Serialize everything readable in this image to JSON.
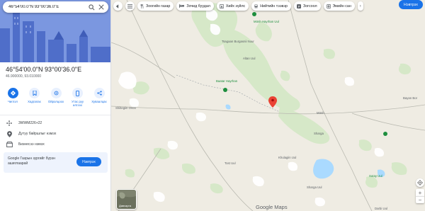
{
  "search": {
    "query": "46°54'00.0\"N 93°00'36.0\"E"
  },
  "place": {
    "title": "46°54'00.0\"N 93°00'36.0\"E",
    "coords": "46.900000, 93.010000"
  },
  "actions": [
    {
      "label": "Чиглэл",
      "icon": "directions-icon"
    },
    {
      "label": "Хадгалах",
      "icon": "bookmark-icon"
    },
    {
      "label": "Ойролцоох",
      "icon": "nearby-icon"
    },
    {
      "label": "Утас руу илгээх",
      "icon": "phone-icon"
    },
    {
      "label": "Хуваалцах",
      "icon": "share-icon"
    }
  ],
  "info_rows": [
    {
      "text": "3WWM226+22",
      "icon": "plus-code-icon"
    },
    {
      "text": "Дутуу байршлыг нэмэх",
      "icon": "add-place-icon"
    },
    {
      "text": "Бизнесээ нэмэх",
      "icon": "business-icon"
    }
  ],
  "ad_card": {
    "text": "Google Газрын зургийг бүрэн ашиглаарай",
    "button": "Нэвтрэх"
  },
  "chips": [
    {
      "label": "Зоогийн газар",
      "icon": "restaurant-icon"
    },
    {
      "label": "Зочид буудал",
      "icon": "hotel-icon"
    },
    {
      "label": "Хийх зүйлс",
      "icon": "things-icon"
    },
    {
      "label": "Нийтийн тээвэр",
      "icon": "transit-icon"
    },
    {
      "label": "Зогсоол",
      "icon": "parking-icon"
    },
    {
      "label": "Эмийн сан",
      "icon": "pharmacy-icon"
    }
  ],
  "login_button": "Нэвтрэх",
  "layers_label": "Давхарга",
  "map_labels": [
    {
      "text": "Tsagaan Burgasnii Nuur",
      "green": false
    },
    {
      "text": "Tsagaan Burgasnii Nuur",
      "green": false
    },
    {
      "text": "Tsagaan Burgasnii Nuur",
      "green": false
    },
    {
      "text": "Altan Uul",
      "green": false
    },
    {
      "text": "Baatar Hayrhan",
      "green": true
    },
    {
      "text": "Baatar Hayrhan",
      "green": false
    },
    {
      "text": "Mönh Hayrhan Uul",
      "green": true
    },
    {
      "text": "Mönh Hayrhan Uul",
      "green": false
    },
    {
      "text": "Shiltegiin Ovoo",
      "green": false
    },
    {
      "text": "Mönh",
      "green": false
    },
    {
      "text": "Möröö Uul",
      "green": false
    },
    {
      "text": "Bayan Bor",
      "green": false
    },
    {
      "text": "Shavar Uul",
      "green": false
    },
    {
      "text": "Sharga",
      "green": false
    },
    {
      "text": "Khulagiin Uul",
      "green": false
    },
    {
      "text": "Tost Uul",
      "green": false
    },
    {
      "text": "Sutay Uul",
      "green": true
    },
    {
      "text": "Khar Nuur",
      "green": false
    },
    {
      "text": "Baga Nuur",
      "green": false
    },
    {
      "text": "Bor Nuur",
      "green": false
    },
    {
      "text": "Sharga Uul",
      "green": false
    },
    {
      "text": "Bayan",
      "green": false
    },
    {
      "text": "Darbi Uul",
      "green": false
    },
    {
      "text": "Nuur",
      "green": false
    },
    {
      "text": "Uul",
      "green": false
    }
  ],
  "map_brand": "Google Maps",
  "colors": {
    "accent": "#1a73e8",
    "pin": "#ea4335",
    "park_green": "#1e8e3e",
    "map_bg": "#efece3",
    "vegetation": "#d3e6c4",
    "water": "#aadaff"
  }
}
